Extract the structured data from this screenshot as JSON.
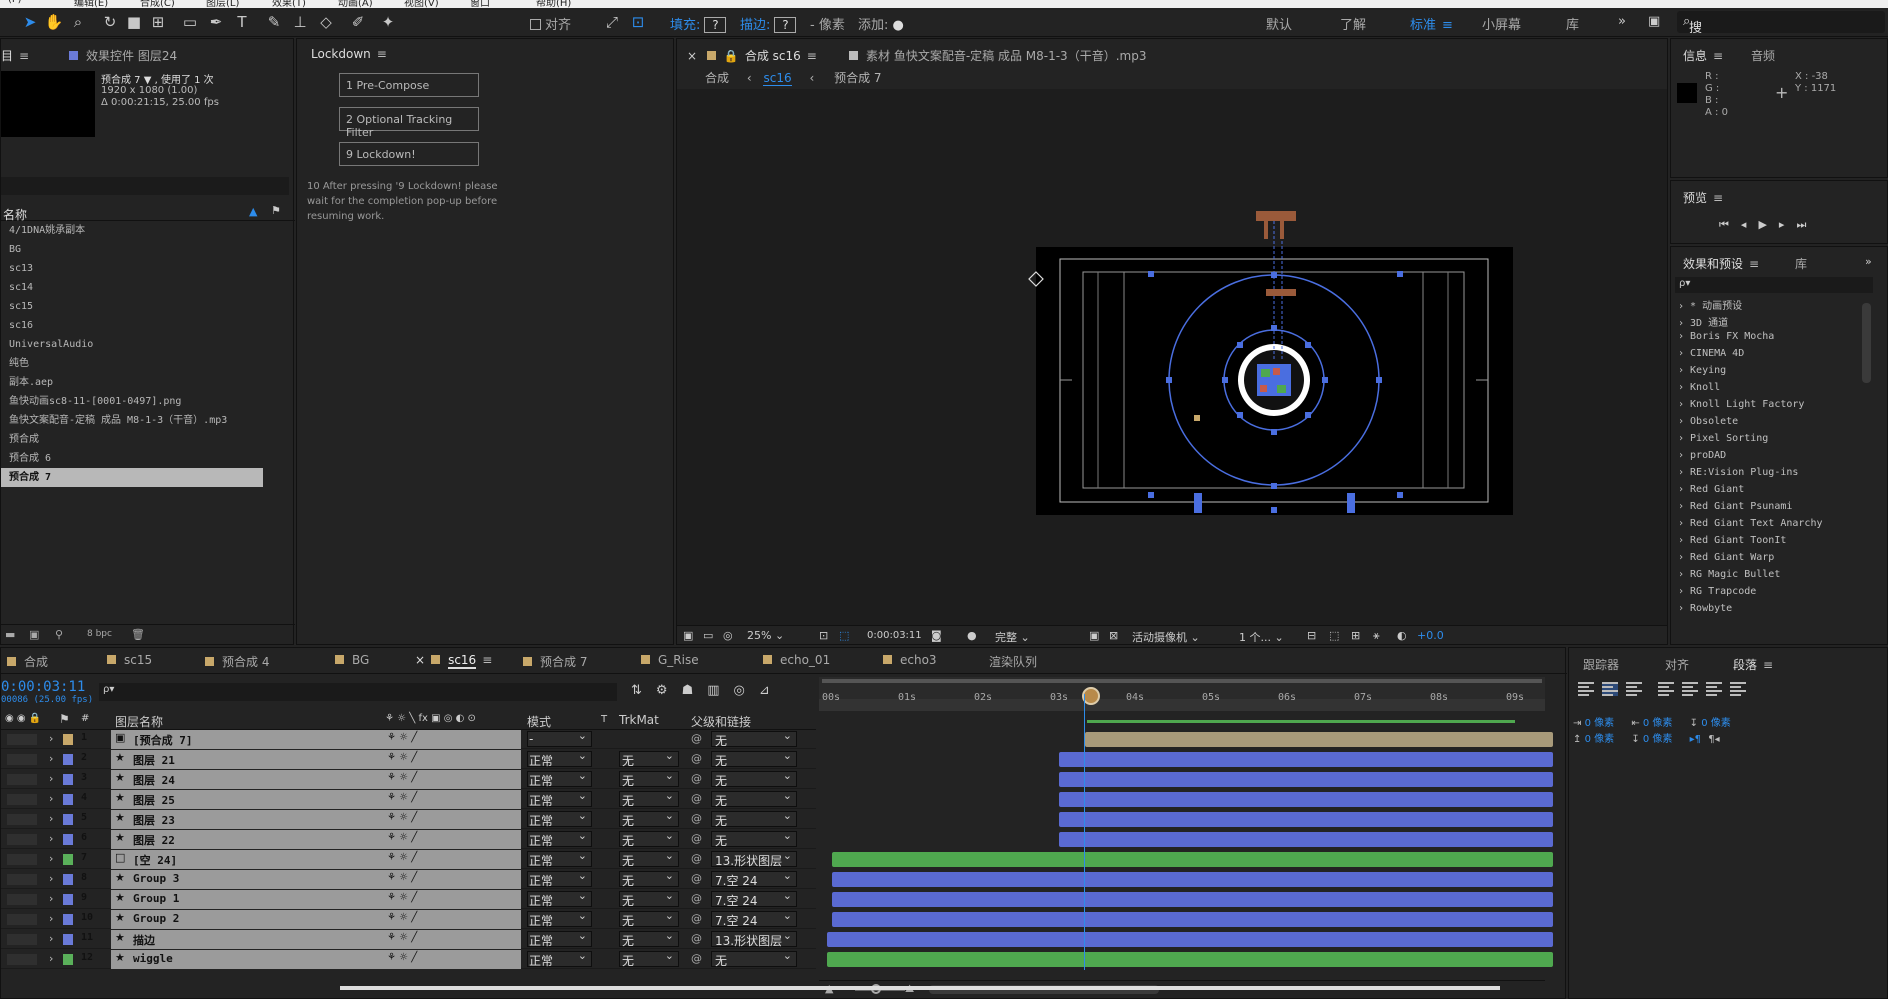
{
  "menubar": {
    "items": [
      "(F)",
      "编辑(E)",
      "合成(C)",
      "图层(L)",
      "效果(T)",
      "动画(A)",
      "视图(V)",
      "窗口",
      "帮助(H)"
    ]
  },
  "toolbar": {
    "snap_label": "对齐",
    "fill_label": "填充:",
    "fill_value": "?",
    "stroke_label": "描边:",
    "stroke_value": "?",
    "stroke_unit": "- 像素",
    "add_label": "添加:",
    "workspaces": [
      "默认",
      "了解",
      "标准",
      "小屏幕",
      "库"
    ],
    "active_workspace": "标准",
    "search_placeholder": "搜索帮助"
  },
  "project_panel": {
    "tab_project": "目",
    "tab_effect_controls": "效果控件 图层24",
    "comp_name": "预合成 7 ▼ , 使用了 1 次",
    "comp_res": "1920 x 1080 (1.00)",
    "comp_duration": "Δ 0:00:21:15, 25.00 fps",
    "column_name": "名称",
    "items": [
      {
        "name": "4/1DNA姚承副本",
        "color": "#c8a86a"
      },
      {
        "name": "BG",
        "color": "#c8a86a"
      },
      {
        "name": "sc13",
        "color": "#c8a86a"
      },
      {
        "name": "sc14",
        "color": "#c8a86a"
      },
      {
        "name": "sc15",
        "color": "#c8a86a"
      },
      {
        "name": "sc16",
        "color": "#c8a86a"
      },
      {
        "name": "UniversalAudio",
        "color": "#e8d47a"
      },
      {
        "name": "纯色",
        "color": "#e8d47a"
      },
      {
        "name": "副本.aep",
        "color": "#c8a86a"
      },
      {
        "name": "鱼快动画sc8-11-[0001-0497].png",
        "color": "#7ac8c8"
      },
      {
        "name": "鱼快文案配音-定稿 成品 M8-1-3（干音）.mp3",
        "color": "#7ac8c8"
      },
      {
        "name": "预合成",
        "color": "#e8d47a"
      },
      {
        "name": "预合成 6",
        "color": "#c8a86a"
      },
      {
        "name": "预合成 7",
        "color": "#c8a86a"
      }
    ],
    "bpc": "8 bpc"
  },
  "lockdown_panel": {
    "title": "Lockdown",
    "buttons": [
      "1 Pre-Compose",
      "2 Optional Tracking Filter",
      "9 Lockdown!"
    ],
    "note": "10 After pressing '9 Lockdown! please wait for the completion pop-up before resuming work."
  },
  "comp_panel": {
    "tab_label": "合成 sc16",
    "footage_tab": "素材 鱼快文案配音-定稿 成品 M8-1-3（干音）.mp3",
    "breadcrumb": [
      "合成",
      "sc16",
      "预合成 7"
    ],
    "zoom": "25%",
    "timecode": "0:00:03:11",
    "resolution": "完整",
    "camera": "活动摄像机",
    "views": "1 个...",
    "exposure": "+0.0"
  },
  "info_panel": {
    "tab_info": "信息",
    "tab_audio": "音频",
    "r": "R :",
    "g": "G :",
    "b": "B :",
    "a": "A : 0",
    "x": "X : -38",
    "y": "Y : 1171"
  },
  "preview_panel": {
    "title": "预览"
  },
  "effects_panel": {
    "title": "效果和预设",
    "tab_library": "库",
    "search_placeholder": "ρ▾",
    "items": [
      "* 动画预设",
      "3D 通道",
      "Boris FX Mocha",
      "CINEMA 4D",
      "Keying",
      "Knoll",
      "Knoll Light Factory",
      "Obsolete",
      "Pixel Sorting",
      "proDAD",
      "RE:Vision Plug-ins",
      "Red Giant",
      "Red Giant Psunami",
      "Red Giant Text Anarchy",
      "Red Giant ToonIt",
      "Red Giant Warp",
      "RG Magic Bullet",
      "RG Trapcode",
      "Rowbyte"
    ]
  },
  "paragraph_panel": {
    "tabs": [
      "跟踪器",
      "对齐",
      "段落"
    ],
    "active": "段落",
    "indent_left": "0 像素",
    "indent_right": "0 像素",
    "indent_first": "0 像素",
    "space_before": "0 像素",
    "space_after": "0 像素"
  },
  "timeline": {
    "tabs": [
      "合成",
      "sc15",
      "预合成 4",
      "BG",
      "sc16",
      "预合成 7",
      "G_Rise",
      "echo_01",
      "echo3",
      "渲染队列"
    ],
    "tab_colors": [
      "#c8a86a",
      "#c8a86a",
      "#c8a86a",
      "#c8a86a",
      "#c8a86a",
      "#c8a86a",
      "#c8a86a",
      "#c8a86a",
      "#c8a86a",
      ""
    ],
    "active_tab": "sc16",
    "timecode": "0:00:03:11",
    "frames": "00086 (25.00 fps)",
    "search_placeholder": "ρ▾",
    "col_name": "图层名称",
    "col_mode": "模式",
    "col_t": "T",
    "col_trkmat": "TrkMat",
    "col_parent": "父级和链接",
    "ruler": [
      "00s",
      "01s",
      "02s",
      "03s",
      "04s",
      "05s",
      "06s",
      "07s",
      "08s",
      "09s"
    ],
    "layers": [
      {
        "num": "1",
        "name": "[预合成 7]",
        "label": "#c8a86a",
        "mode": "-",
        "trk": "",
        "parent": "无",
        "bar": "#a89a7a",
        "start": 3.45,
        "end": 9.6
      },
      {
        "num": "2",
        "name": "图层 21",
        "label": "#6a7ad8",
        "mode": "正常",
        "trk": "无",
        "parent": "无",
        "bar": "#5a6ad2",
        "start": 3.1,
        "end": 9.6
      },
      {
        "num": "3",
        "name": "图层 24",
        "label": "#6a7ad8",
        "mode": "正常",
        "trk": "无",
        "parent": "无",
        "bar": "#5a6ad2",
        "start": 3.1,
        "end": 9.6
      },
      {
        "num": "4",
        "name": "图层 25",
        "label": "#6a7ad8",
        "mode": "正常",
        "trk": "无",
        "parent": "无",
        "bar": "#5a6ad2",
        "start": 3.1,
        "end": 9.6
      },
      {
        "num": "5",
        "name": "图层 23",
        "label": "#6a7ad8",
        "mode": "正常",
        "trk": "无",
        "parent": "无",
        "bar": "#5a6ad2",
        "start": 3.1,
        "end": 9.6
      },
      {
        "num": "6",
        "name": "图层 22",
        "label": "#6a7ad8",
        "mode": "正常",
        "trk": "无",
        "parent": "无",
        "bar": "#5a6ad2",
        "start": 3.1,
        "end": 9.6
      },
      {
        "num": "7",
        "name": "[空 24]",
        "label": "#5ab05a",
        "mode": "正常",
        "trk": "无",
        "parent": "13.形状图层",
        "bar": "#4fa84f",
        "start": 0.12,
        "end": 9.6
      },
      {
        "num": "8",
        "name": "Group 3",
        "label": "#6a7ad8",
        "mode": "正常",
        "trk": "无",
        "parent": "7.空 24",
        "bar": "#5a6ad2",
        "start": 0.12,
        "end": 9.6
      },
      {
        "num": "9",
        "name": "Group 1",
        "label": "#6a7ad8",
        "mode": "正常",
        "trk": "无",
        "parent": "7.空 24",
        "bar": "#5a6ad2",
        "start": 0.12,
        "end": 9.6
      },
      {
        "num": "10",
        "name": "Group 2",
        "label": "#6a7ad8",
        "mode": "正常",
        "trk": "无",
        "parent": "7.空 24",
        "bar": "#5a6ad2",
        "start": 0.12,
        "end": 9.6
      },
      {
        "num": "11",
        "name": "描边",
        "label": "#6a7ad8",
        "mode": "正常",
        "trk": "无",
        "parent": "13.形状图层",
        "bar": "#5a6ad2",
        "start": 0.05,
        "end": 9.6
      },
      {
        "num": "12",
        "name": "wiggle",
        "label": "#5ab05a",
        "mode": "正常",
        "trk": "无",
        "parent": "无",
        "bar": "#4fa84f",
        "start": 0.05,
        "end": 9.6
      }
    ]
  },
  "colors": {
    "accent": "#2d8ceb",
    "panel": "#232323",
    "viewer": "#1d1d1d",
    "handle": "#4a6ee0"
  }
}
